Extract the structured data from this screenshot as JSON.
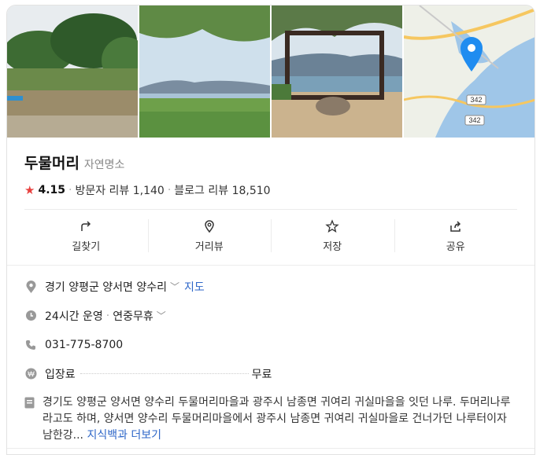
{
  "place": {
    "name": "두물머리",
    "category": "자연명소",
    "rating": "4.15",
    "visitor_reviews": "방문자 리뷰 1,140",
    "blog_reviews": "블로그 리뷰 18,510"
  },
  "map": {
    "road_label_1": "342",
    "road_label_2": "342"
  },
  "actions": [
    {
      "label": "길찾기",
      "icon": "directions-icon"
    },
    {
      "label": "거리뷰",
      "icon": "street-view-icon"
    },
    {
      "label": "저장",
      "icon": "star-icon"
    },
    {
      "label": "공유",
      "icon": "share-icon"
    }
  ],
  "details": {
    "address": "경기 양평군 양서면 양수리",
    "map_link": "지도",
    "hours": "24시간 운영",
    "hours_extra": "연중무휴",
    "phone": "031-775-8700",
    "fee_label": "입장료",
    "fee_value": "무료",
    "description": "경기도 양평군 양서면 양수리 두물머리마을과 광주시 남종면 귀여리 귀실마을을 잇던 나루. 두머리나루라고도 하며, 양서면 양수리 두물머리마을에서 광주시 남종면 귀여리 귀실마을로 건너가던 나루터이자 남한강...",
    "more_link": "지식백과 더보기"
  },
  "colors": {
    "accent": "#2d66c8",
    "star": "#e8413f",
    "pin": "#1f8cf0"
  }
}
